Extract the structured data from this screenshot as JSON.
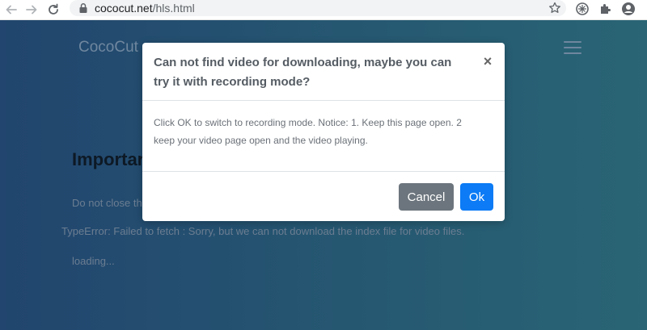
{
  "browser": {
    "url_host": "cococut.net",
    "url_path": "/hls.html"
  },
  "page": {
    "brand": "CocoCut",
    "heading": "Importar",
    "note": "Do not close thi",
    "error": "TypeError: Failed to fetch : Sorry, but we can not download the index file for video files.",
    "loading": "loading..."
  },
  "modal": {
    "title": "Can not find video for downloading, maybe you can try it with recording mode?",
    "close": "×",
    "body": "Click OK to switch to recording mode. Notice: 1. Keep this page open. 2 keep your video page open and the video playing.",
    "cancel_label": "Cancel",
    "ok_label": "Ok"
  },
  "colors": {
    "cancel": "#6c757d",
    "ok": "#0c7bf5",
    "page_gradient_start": "#264f7e",
    "page_gradient_end": "#2f7385"
  }
}
